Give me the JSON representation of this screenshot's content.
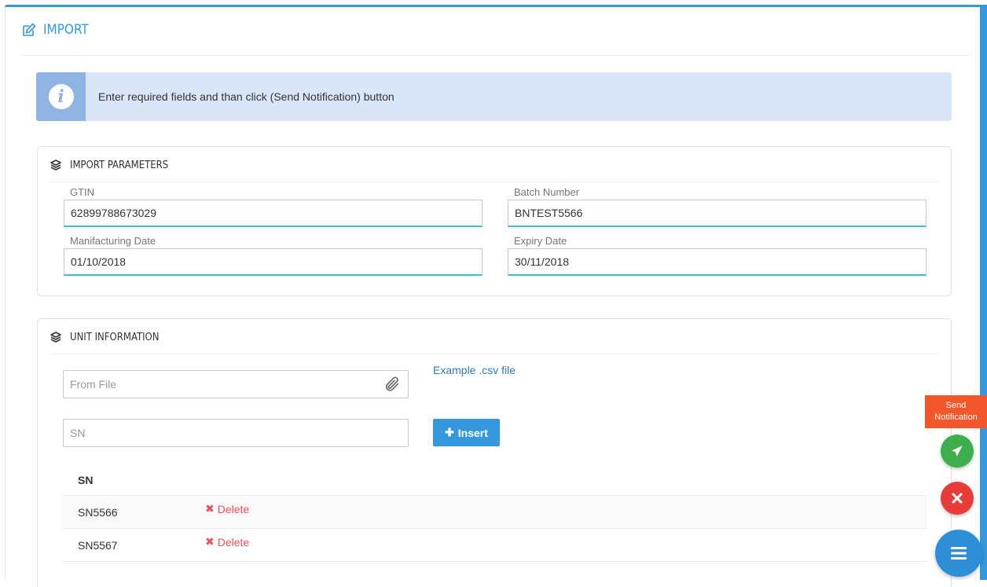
{
  "header": {
    "title": "IMPORT",
    "icon": "edit-icon"
  },
  "alert": {
    "icon": "info-icon",
    "text": "Enter required fields and than click (Send Notification) button"
  },
  "import_parameters": {
    "title": "IMPORT PARAMETERS",
    "icon": "layers-icon",
    "fields": {
      "gtin": {
        "label": "GTIN",
        "value": "62899788673029"
      },
      "batch": {
        "label": "Batch Number",
        "value": "BNTEST5566"
      },
      "manufacturing": {
        "label": "Manifacturing Date",
        "value": "01/10/2018"
      },
      "expiry": {
        "label": "Expiry Date",
        "value": "30/11/2018"
      }
    }
  },
  "unit_information": {
    "title": "UNIT INFORMATION",
    "icon": "layers-icon",
    "file_placeholder": "From File",
    "example_link": "Example .csv file",
    "sn_placeholder": "SN",
    "insert_label": "Insert",
    "table": {
      "header": "SN",
      "rows": [
        {
          "sn": "SN5566",
          "action": "Delete"
        },
        {
          "sn": "SN5567",
          "action": "Delete"
        }
      ]
    }
  },
  "fab": {
    "send_label_line1": "Send",
    "send_label_line2": "Notification",
    "colors": {
      "send": "#3dae4c",
      "close": "#e73d3a",
      "menu": "#2f8fd6",
      "label": "#f2572b"
    }
  },
  "colors": {
    "accent": "#3598dc",
    "input_underline": "#36c6d3",
    "danger": "#e7505a",
    "alert_bg": "#d9e6f7"
  }
}
